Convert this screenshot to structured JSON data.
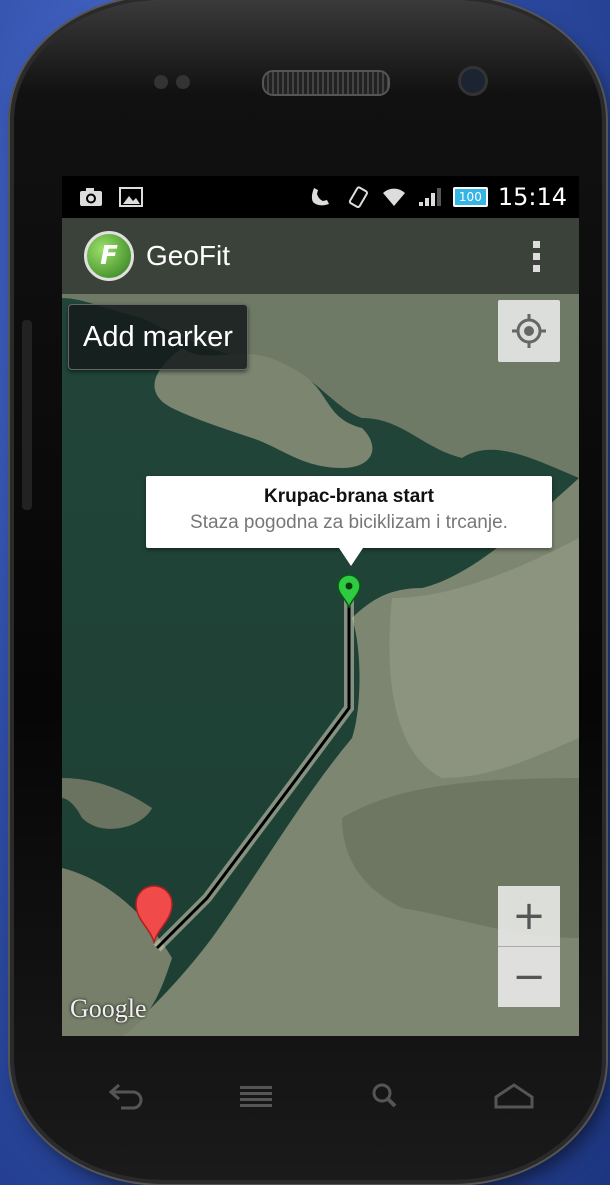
{
  "status_bar": {
    "icons_left": [
      "camera-icon",
      "image-icon"
    ],
    "icons_right": [
      "phone-call-icon",
      "vibrate-icon",
      "wifi-icon",
      "signal-icon"
    ],
    "battery_level": "100",
    "time": "15:14"
  },
  "action_bar": {
    "logo_letter": "F",
    "title": "GeoFit"
  },
  "map": {
    "add_marker_label": "Add marker",
    "zoom_in_label": "+",
    "zoom_out_label": "−",
    "attribution": "Google",
    "info_window": {
      "title": "Krupac-brana start",
      "snippet": "Staza pogodna za biciklizam i trcanje."
    },
    "start_marker_color": "#2ecc40",
    "end_marker_color": "#f04a4a"
  },
  "nav_bar": {
    "buttons": [
      "back-icon",
      "menu-icon",
      "search-icon",
      "home-icon"
    ]
  }
}
